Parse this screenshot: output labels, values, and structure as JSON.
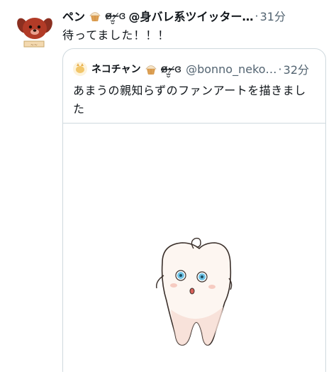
{
  "tweet": {
    "display_name": "ペン",
    "kaomoji": "ɞ̴̶̷·̫̮ ̷̴̶ɞ",
    "handle_suffix": "@身バレ系ツイッター…",
    "separator": "·",
    "time": "31分",
    "text": "待ってました！！！",
    "avatar_icon": "dog-avatar-icon"
  },
  "quote": {
    "display_name": "ネコチャン",
    "kaomoji": "ɞ̴̶̷·̫̮ ̷̴̶ɞ",
    "handle": "@bonno_neko…",
    "separator": "·",
    "time": "32分",
    "text": "あまうの親知らずのファンアートを描きました",
    "media_icon": "tooth-character-illustration"
  }
}
